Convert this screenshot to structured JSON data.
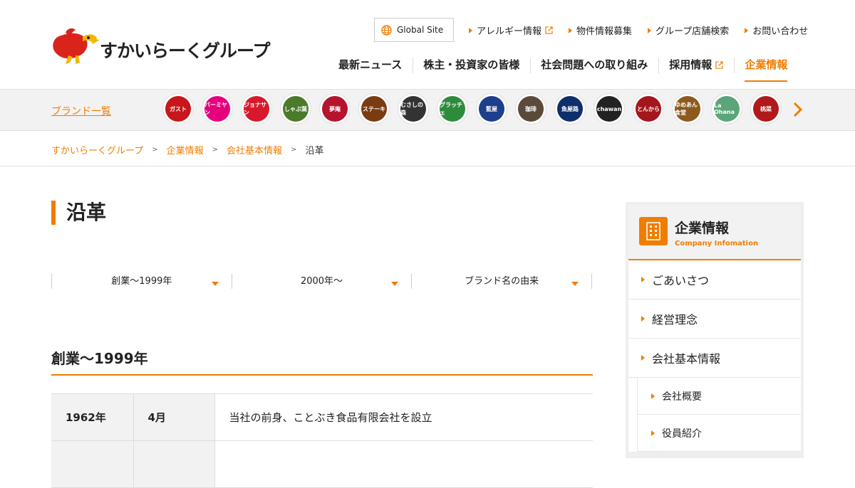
{
  "header": {
    "logo_text": "すかいらーくグループ",
    "global_site": "Global Site",
    "util_links": [
      {
        "label": "アレルギー情報",
        "external": true
      },
      {
        "label": "物件情報募集",
        "external": false
      },
      {
        "label": "グループ店舗検索",
        "external": false
      },
      {
        "label": "お問い合わせ",
        "external": false
      }
    ],
    "nav": [
      {
        "label": "最新ニュース"
      },
      {
        "label": "株主・投資家の皆様"
      },
      {
        "label": "社会問題への取り組み"
      },
      {
        "label": "採用情報"
      },
      {
        "label": "企業情報"
      }
    ]
  },
  "brands": {
    "title": "ブランド一覧",
    "items": [
      {
        "label": "ガスト",
        "color": "#c8161d"
      },
      {
        "label": "バーミヤン",
        "color": "#e6007e"
      },
      {
        "label": "ジョナサン",
        "color": "#d7192b"
      },
      {
        "label": "しゃぶ葉",
        "color": "#4a7a2a"
      },
      {
        "label": "夢庵",
        "color": "#b5142c"
      },
      {
        "label": "ステーキ",
        "color": "#7a3b12"
      },
      {
        "label": "むさしの森",
        "color": "#333333"
      },
      {
        "label": "グラッチェ",
        "color": "#2d8c3c"
      },
      {
        "label": "藍屋",
        "color": "#1e3f8a"
      },
      {
        "label": "珈琲",
        "color": "#5a4a3a"
      },
      {
        "label": "魚屋路",
        "color": "#0e2f6b"
      },
      {
        "label": "chawan",
        "color": "#222222"
      },
      {
        "label": "とんから",
        "color": "#a5151c"
      },
      {
        "label": "ゆめあん食堂",
        "color": "#8c5a1e"
      },
      {
        "label": "La Ohana",
        "color": "#5aa57a"
      },
      {
        "label": "桃菜",
        "color": "#b01a1a"
      }
    ]
  },
  "breadcrumb": {
    "items": [
      "すかいらーくグループ",
      "企業情報",
      "会社基本情報"
    ],
    "current": "沿革",
    "separator": ">"
  },
  "page_title": "沿革",
  "anchor_tabs": [
    {
      "label": "創業～1999年"
    },
    {
      "label": "2000年～"
    },
    {
      "label": "ブランド名の由来"
    }
  ],
  "section": {
    "heading": "創業～1999年",
    "rows": [
      {
        "year": "1962年",
        "month": "4月",
        "event": "当社の前身、ことぶき食品有限会社を設立"
      },
      {
        "year": "",
        "month": "",
        "event": ""
      }
    ]
  },
  "sidebar": {
    "title": "企業情報",
    "subtitle": "Company Infomation",
    "items": [
      {
        "label": "ごあいさつ"
      },
      {
        "label": "経営理念"
      },
      {
        "label": "会社基本情報"
      }
    ],
    "subitems": [
      {
        "label": "会社概要"
      },
      {
        "label": "役員紹介"
      }
    ]
  },
  "colors": {
    "accent": "#f07d00",
    "strip_bg": "#f2f2f2",
    "table_head_bg": "#f2f2f2"
  }
}
